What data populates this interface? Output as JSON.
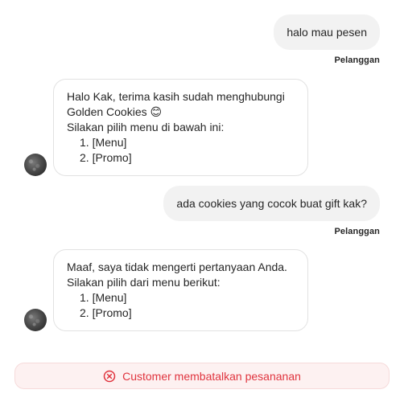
{
  "messages": [
    {
      "direction": "outgoing",
      "text": "halo mau pesen",
      "sender": "Pelanggan"
    },
    {
      "direction": "incoming",
      "lines": [
        "Halo Kak, terima kasih sudah menghubungi",
        "Golden Cookies 😊",
        "Silakan pilih menu di bawah ini:"
      ],
      "options": [
        "1. [Menu]",
        "2. [Promo]"
      ]
    },
    {
      "direction": "outgoing",
      "text": "ada cookies yang cocok buat gift kak?",
      "sender": "Pelanggan"
    },
    {
      "direction": "incoming",
      "lines": [
        "Maaf, saya tidak mengerti pertanyaan Anda.",
        "Silakan pilih dari menu berikut:"
      ],
      "options": [
        "1. [Menu]",
        "2. [Promo]"
      ]
    }
  ],
  "status_banner": {
    "text": "Customer membatalkan pesananan",
    "icon": "x-circle-icon",
    "color": "#e0343e",
    "background": "#fdf1f1"
  }
}
